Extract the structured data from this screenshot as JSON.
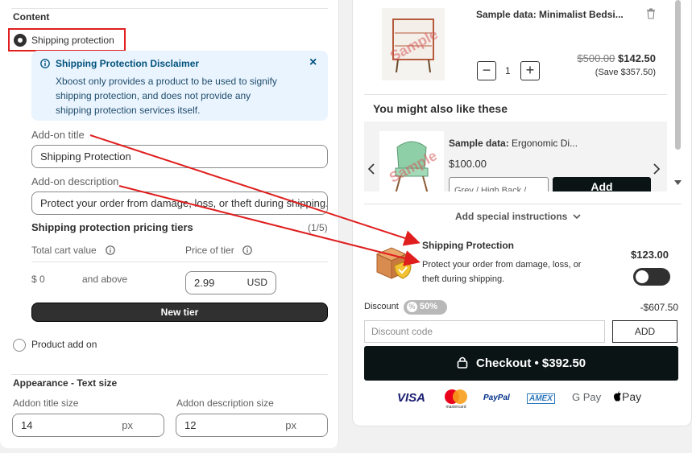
{
  "left": {
    "content_heading": "Content",
    "shipping_option_label": "Shipping protection",
    "disclaimer": {
      "title": "Shipping Protection Disclaimer",
      "body_line1": "Xboost only provides a product to be used to signify",
      "body_line2": "shipping protection, and does not provide any",
      "body_line3": "shipping protection services itself.",
      "close_glyph": "×"
    },
    "addon_title_label": "Add-on title",
    "addon_title_value": "Shipping Protection",
    "addon_desc_label": "Add-on description",
    "addon_desc_value": "Protect your order from damage, loss, or theft during shipping.",
    "tiers_heading": "Shipping protection pricing tiers",
    "tiers_count": "(1/5)",
    "col_total": "Total cart value",
    "col_price": "Price of tier",
    "tier_min": "$ 0",
    "tier_and_above": "and above",
    "tier_price": "2.99",
    "tier_currency": "USD",
    "new_tier_button": "New tier",
    "product_addon_label": "Product add on",
    "appearance_heading": "Appearance - Text size",
    "addon_title_size_label": "Addon title size",
    "addon_title_size_value": "14",
    "addon_desc_size_label": "Addon description size",
    "addon_desc_size_value": "12",
    "px_unit": "px"
  },
  "cart": {
    "item": {
      "prefix": "Sample data:",
      "name": "Minimalist Bedsi...",
      "qty": "1",
      "minus": "−",
      "plus": "+",
      "old_price": "$500.00",
      "price": "$142.50",
      "save": "(Save $357.50)",
      "watermark": "Sample"
    },
    "upsell_heading": "You might also like these",
    "upsell": {
      "prefix": "Sample data:",
      "name": "Ergonomic Di...",
      "price": "$100.00",
      "variant": "Grey / High Back / ...",
      "add_button": "Add",
      "watermark": "Sample"
    },
    "special_instructions": "Add special instructions",
    "protection": {
      "title": "Shipping Protection",
      "desc_line1": "Protect your order from damage, loss, or",
      "desc_line2": "theft during shipping.",
      "price": "$123.00",
      "toggle_on": false
    },
    "discount_label": "Discount",
    "discount_badge": "50%",
    "discount_amount": "-$607.50",
    "discount_placeholder": "Discount code",
    "discount_apply": "ADD",
    "checkout_button": "Checkout • $392.50",
    "payments": [
      "VISA",
      "mastercard",
      "PayPal",
      "AMEX",
      "G Pay",
      "Pay"
    ]
  },
  "colors": {
    "highlight_red": "#e01e1e",
    "info_bg": "#eaf4ff",
    "checkout_bg": "#0b1414"
  }
}
